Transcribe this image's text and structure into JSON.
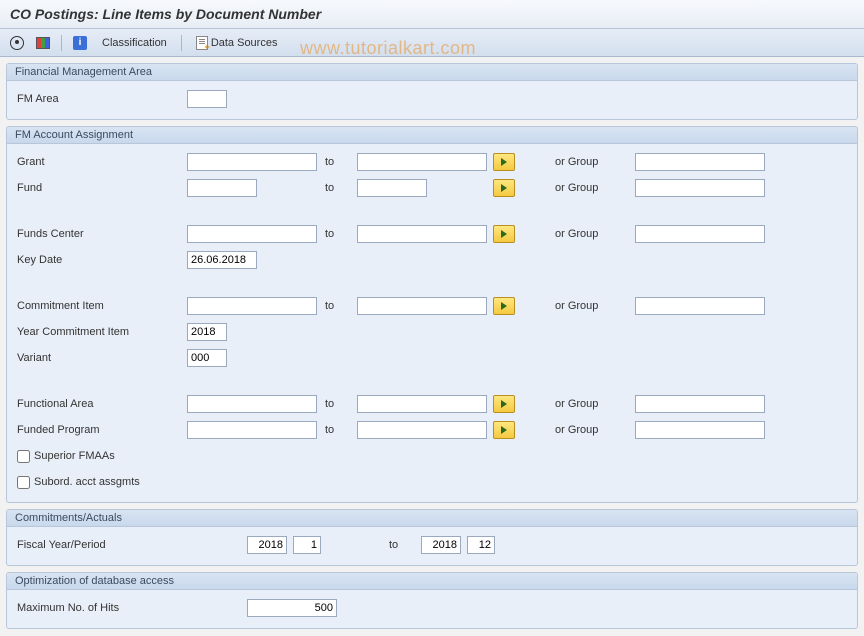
{
  "title": "CO Postings: Line Items by Document Number",
  "toolbar": {
    "classification": "Classification",
    "data_sources": "Data Sources"
  },
  "watermark": "www.tutorialkart.com",
  "groups": {
    "fma": {
      "header": "Financial Management Area",
      "fm_area_label": "FM Area",
      "fm_area_value": ""
    },
    "fmaa": {
      "header": "FM Account Assignment",
      "grant_label": "Grant",
      "fund_label": "Fund",
      "funds_center_label": "Funds Center",
      "key_date_label": "Key Date",
      "key_date_value": "26.06.2018",
      "commitment_item_label": "Commitment Item",
      "year_ci_label": "Year Commitment Item",
      "year_ci_value": "2018",
      "variant_label": "Variant",
      "variant_value": "000",
      "functional_area_label": "Functional Area",
      "funded_program_label": "Funded Program",
      "superior_label": "Superior FMAAs",
      "subord_label": "Subord. acct assgmts",
      "to_label": "to",
      "or_group_label": "or Group"
    },
    "ca": {
      "header": "Commitments/Actuals",
      "fyp_label": "Fiscal Year/Period",
      "from_year": "2018",
      "from_period": "1",
      "to_year": "2018",
      "to_period": "12",
      "to_label": "to"
    },
    "opt": {
      "header": "Optimization of database access",
      "max_hits_label": "Maximum No. of Hits",
      "max_hits_value": "500"
    }
  }
}
